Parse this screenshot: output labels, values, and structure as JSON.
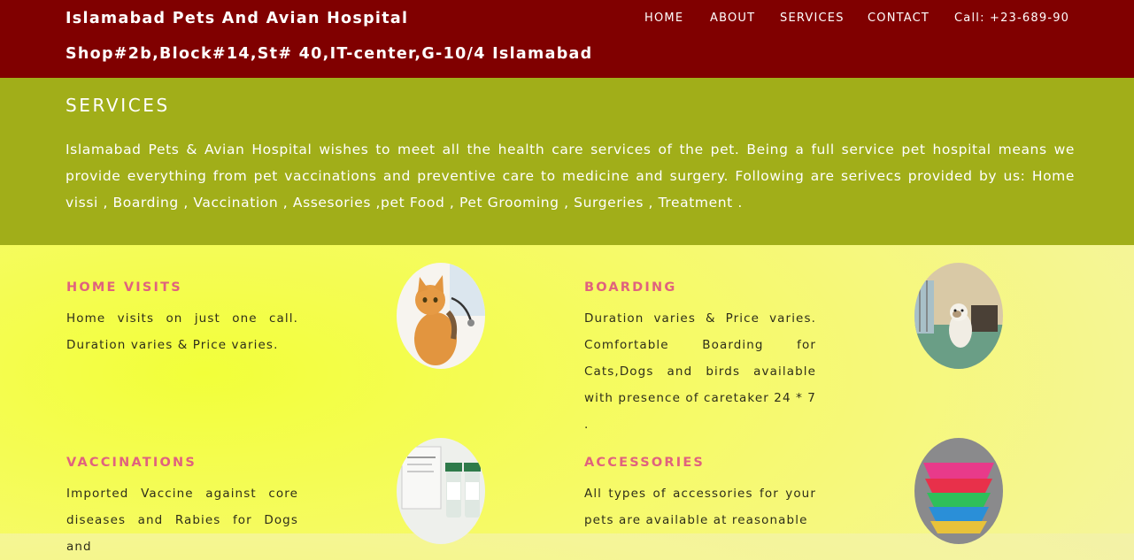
{
  "header": {
    "name": "Islamabad Pets And Avian Hospital",
    "address": "Shop#2b,Block#14,St# 40,IT-center,G-10/4 Islamabad"
  },
  "nav": {
    "home": "HOME",
    "about": "ABOUT",
    "services": "SERVICES",
    "contact": "CONTACT",
    "call": "Call: +23-689-90"
  },
  "intro": {
    "title": "SERVICES",
    "text": "Islamabad Pets & Avian Hospital wishes to meet all the health care services of the pet. Being a full service pet hospital means we provide everything from pet vaccinations and preventive care to medicine and surgery. Following are serivecs provided by us: Home vissi , Boarding , Vaccination , Assesories ,pet Food , Pet Grooming , Surgeries , Treatment ."
  },
  "services": [
    {
      "title": "HOME VISITS",
      "desc": "Home visits on just one call. Duration varies & Price varies.",
      "image": "cat-with-stethoscope"
    },
    {
      "title": "BOARDING",
      "desc": "Duration varies & Price varies. Comfortable Boarding for Cats,Dogs and birds available with presence of caretaker 24 * 7 .",
      "image": "dog-in-kennel"
    },
    {
      "title": "VACCINATIONS",
      "desc": "Imported Vaccine against core diseases and Rabies for Dogs and",
      "image": "vaccine-vials"
    },
    {
      "title": "ACCESSORIES",
      "desc": "All types of accessories for your pets are available at reasonable",
      "image": "pet-bowls"
    }
  ],
  "colors": {
    "header": "#800000",
    "band": "#a1ae19",
    "accent": "#e0627e"
  }
}
